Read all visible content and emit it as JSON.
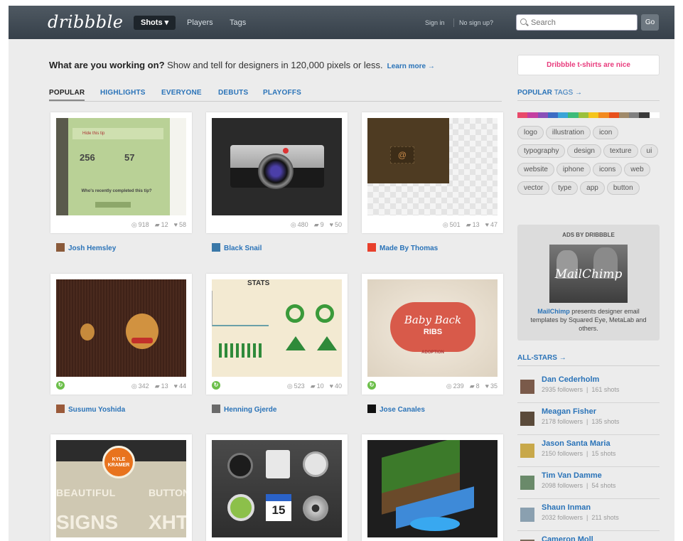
{
  "header": {
    "logo": "dribbble",
    "nav_shots": "Shots ▾",
    "nav_players": "Players",
    "nav_tags": "Tags",
    "sign_in": "Sign in",
    "no_signup": "No sign up?",
    "search_placeholder": "Search",
    "go": "Go"
  },
  "intro": {
    "bold": "What are you working on?",
    "text": " Show and tell for designers in 120,000 pixels or less.",
    "learn_more": "Learn more →"
  },
  "tabs": [
    "POPULAR",
    "HIGHLIGHTS",
    "EVERYONE",
    "DEBUTS",
    "PLAYOFFS"
  ],
  "shots": [
    {
      "views": "918",
      "comments": "12",
      "likes": "58",
      "author": "Josh Hemsley",
      "rebound": false,
      "thumb_text": [
        "Hide this tip",
        "256",
        "57",
        "Who's recently completed this tip?"
      ]
    },
    {
      "views": "480",
      "comments": "9",
      "likes": "50",
      "author": "Black Snail",
      "rebound": false,
      "thumb_text": []
    },
    {
      "views": "501",
      "comments": "13",
      "likes": "47",
      "author": "Made By Thomas",
      "rebound": false,
      "thumb_text": [
        "@"
      ]
    },
    {
      "views": "342",
      "comments": "13",
      "likes": "44",
      "author": "Susumu Yoshida",
      "rebound": true,
      "thumb_text": []
    },
    {
      "views": "523",
      "comments": "10",
      "likes": "40",
      "author": "Henning Gjerde",
      "rebound": true,
      "thumb_text": [
        "STATS"
      ]
    },
    {
      "views": "239",
      "comments": "8",
      "likes": "35",
      "author": "Jose Canales",
      "rebound": true,
      "thumb_text": [
        "Baby Back",
        "RIBS",
        "ADOPTION"
      ]
    },
    {
      "thumb_text": [
        "KYLE KRAMER",
        "BEAUTIFUL",
        "BUTTON P",
        "SIGNS",
        "XHTM"
      ]
    },
    {
      "thumb_text": [
        "15"
      ]
    },
    {
      "thumb_text": []
    }
  ],
  "sidebar": {
    "tshirt": "Dribbble t-shirts are nice",
    "popular": "POPULAR",
    "tags_label": "TAGS →",
    "swatch_colors": [
      "#e84a6a",
      "#c43fa0",
      "#8a4fb8",
      "#3d6cc4",
      "#3aa4d8",
      "#3dbb7a",
      "#9bc13c",
      "#f5c51c",
      "#f28a1e",
      "#e8501c",
      "#a08a6a",
      "#808080",
      "#3a3a3a",
      "#ffffff"
    ],
    "tags": [
      "logo",
      "illustration",
      "icon",
      "typography",
      "design",
      "texture",
      "ui",
      "website",
      "iphone",
      "icons",
      "web",
      "vector",
      "type",
      "app",
      "button"
    ],
    "ads_heading": "ADS BY DRIBBBLE",
    "ads_image_text": "MailChimp",
    "ads_link": "MailChimp",
    "ads_text": " presents designer email templates by Squared Eye, MetaLab and others.",
    "allstars": "ALL-STARS →",
    "stars": [
      {
        "name": "Dan Cederholm",
        "followers": "2935 followers",
        "shots": "161 shots"
      },
      {
        "name": "Meagan Fisher",
        "followers": "2178 followers",
        "shots": "135 shots"
      },
      {
        "name": "Jason Santa Maria",
        "followers": "2150 followers",
        "shots": "15 shots"
      },
      {
        "name": "Tim Van Damme",
        "followers": "2098 followers",
        "shots": "54 shots"
      },
      {
        "name": "Shaun Inman",
        "followers": "2032 followers",
        "shots": "211 shots"
      },
      {
        "name": "Cameron Moll",
        "followers": "",
        "shots": ""
      }
    ]
  }
}
